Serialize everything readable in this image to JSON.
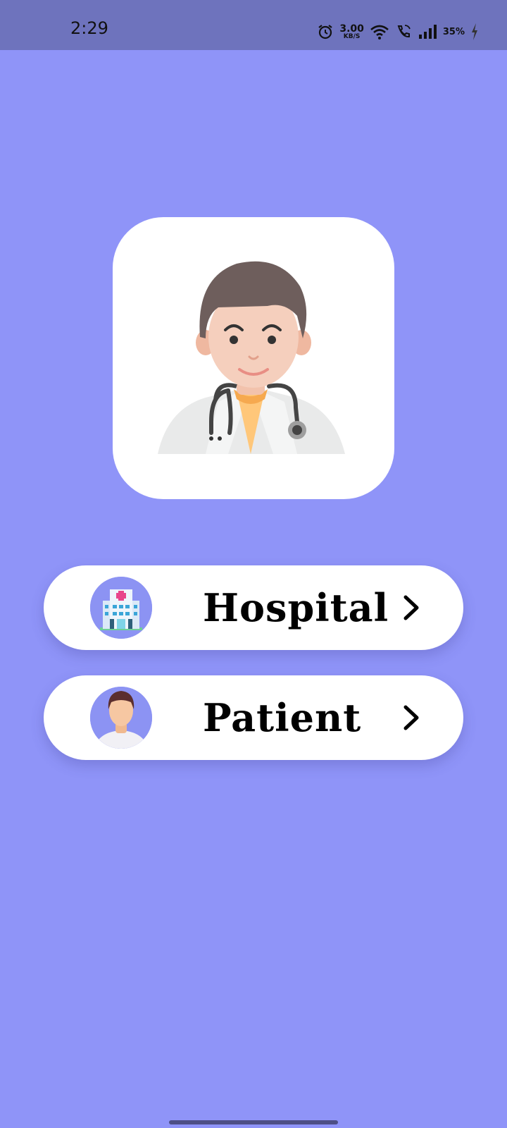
{
  "status_bar": {
    "time": "2:29",
    "net_speed_value": "3.00",
    "net_speed_unit": "KB/S",
    "battery": "35%",
    "icons": [
      "alarm-icon",
      "wifi-icon",
      "wifi-calling-icon",
      "signal-icon",
      "battery-charging-icon"
    ]
  },
  "logo": {
    "icon": "doctor-avatar-icon"
  },
  "roles": [
    {
      "label": "Hospital",
      "icon": "hospital-building-icon"
    },
    {
      "label": "Patient",
      "icon": "patient-avatar-icon"
    }
  ],
  "colors": {
    "background": "#8f94f8",
    "status_bar": "#6e73bd",
    "card": "#ffffff",
    "avatar_bg": "#8c93f3"
  }
}
